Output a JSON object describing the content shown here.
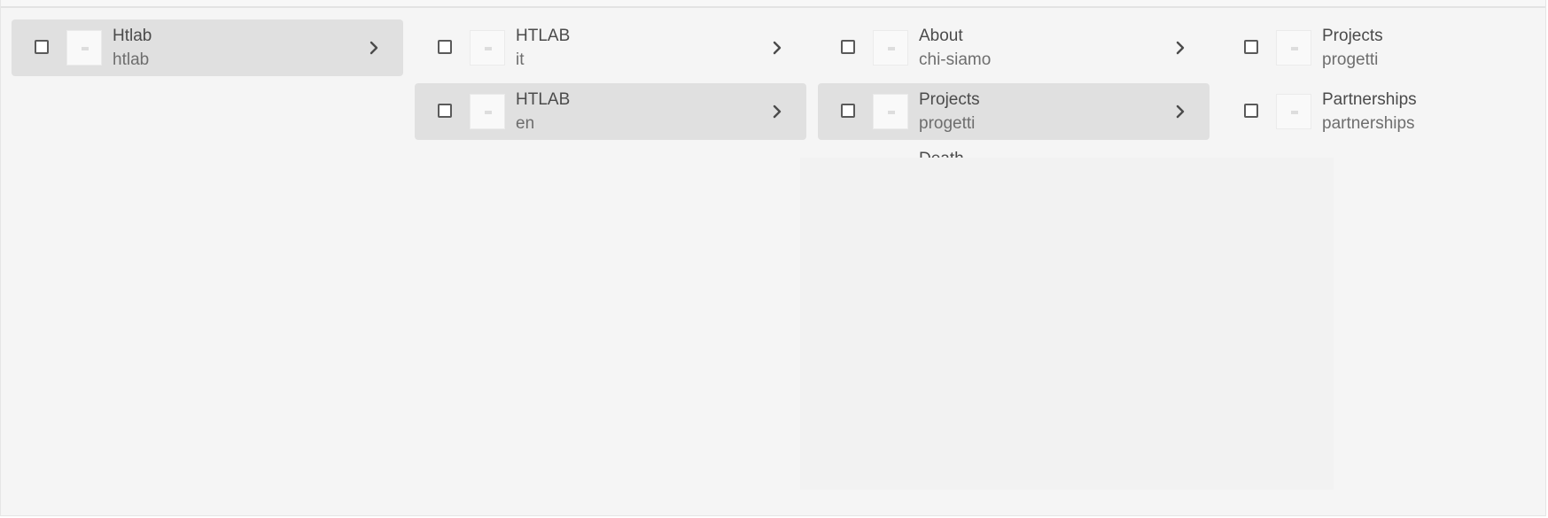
{
  "columns": [
    {
      "items": [
        {
          "title": "Htlab",
          "subtitle": "htlab",
          "selected": true,
          "has_children": true
        }
      ]
    },
    {
      "items": [
        {
          "title": "HTLAB",
          "subtitle": "it",
          "selected": false,
          "has_children": true
        },
        {
          "title": "HTLAB",
          "subtitle": "en",
          "selected": true,
          "has_children": true
        }
      ]
    },
    {
      "items": [
        {
          "title": "About",
          "subtitle": "chi-siamo",
          "selected": false,
          "has_children": true
        },
        {
          "title": "Projects",
          "subtitle": "progetti",
          "selected": true,
          "has_children": true
        }
      ]
    },
    {
      "items": [
        {
          "title": "Projects",
          "subtitle": "progetti",
          "selected": false,
          "has_children": false
        },
        {
          "title": "Partnerships",
          "subtitle": "partnerships",
          "selected": false,
          "has_children": false
        }
      ]
    }
  ],
  "partial_item": {
    "title": "Death"
  },
  "colors": {
    "background": "#f5f5f5",
    "selected_row": "#e0e0e0",
    "text_primary": "#4b4b4b",
    "text_secondary": "#6e6e6e"
  },
  "icons": {
    "row_toggle": "chevron-right-icon",
    "row_thumbnail": "page-thumbnail-icon"
  }
}
